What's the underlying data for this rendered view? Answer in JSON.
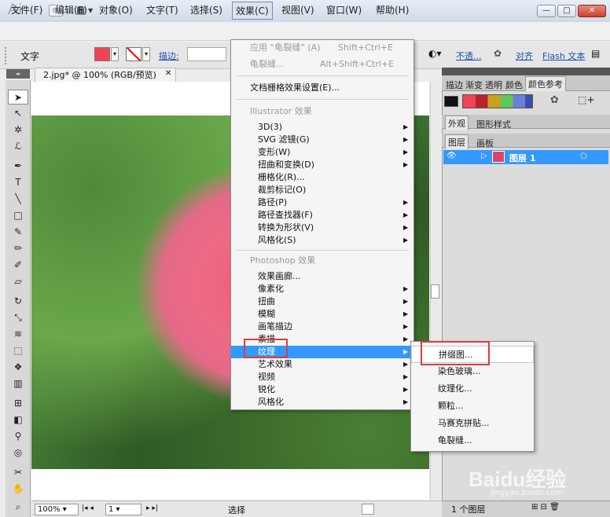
{
  "titlebar": {
    "logo": "Ai",
    "br": "Br",
    "controls": [
      "—",
      "□",
      "✕"
    ]
  },
  "menubar": {
    "items": [
      "文件(F)",
      "编辑(E)",
      "对象(O)",
      "文字(T)",
      "选择(S)",
      "效果(C)",
      "视图(V)",
      "窗口(W)",
      "帮助(H)"
    ]
  },
  "control": {
    "label": "文字",
    "stroke_label": "描边:",
    "opacity": "不透...",
    "align": "对齐",
    "flash_text": "Flash 文本"
  },
  "document": {
    "tab_title": "2.jpg* @ 100% (RGB/预览)",
    "close": "✕"
  },
  "effect_menu": {
    "apply": "应用 “龟裂缝” (A)",
    "apply_shortcut": "Shift+Ctrl+E",
    "last": "龟裂缝...",
    "last_shortcut": "Alt+Shift+Ctrl+E",
    "doc_raster": "文档栅格效果设置(E)...",
    "illustrator_header": "Illustrator 效果",
    "illustrator_items": [
      "3D(3)",
      "SVG 滤镜(G)",
      "变形(W)",
      "扭曲和变换(D)",
      "栅格化(R)...",
      "裁剪标记(O)",
      "路径(P)",
      "路径查找器(F)",
      "转换为形状(V)",
      "风格化(S)"
    ],
    "photoshop_header": "Photoshop 效果",
    "photoshop_items": [
      "效果画廊...",
      "像素化",
      "扭曲",
      "模糊",
      "画笔描边",
      "素描",
      "纹理",
      "艺术效果",
      "视频",
      "锐化",
      "风格化"
    ]
  },
  "texture_submenu": {
    "items": [
      "拼缀图...",
      "染色玻璃...",
      "纹理化...",
      "颗粒...",
      "马赛克拼贴...",
      "龟裂缝..."
    ]
  },
  "panels": {
    "tabs_top": [
      "描边",
      "渐变",
      "透明",
      "颜色",
      "颜色参考"
    ],
    "tabs_mid": [
      "外观",
      "图形样式"
    ],
    "tabs_layers": [
      "图层",
      "画板"
    ],
    "layer_name": "图层 1",
    "layer_count": "1 个图层"
  },
  "status": {
    "zoom": "100%",
    "page": "1",
    "mode": "选择"
  },
  "watermark": {
    "brand": "Baidu经验",
    "url": "jingyan.baidu.com"
  },
  "colors": {
    "fill": "#ee4455",
    "highlight": "#3399ff",
    "callout": "#e23b3b"
  }
}
